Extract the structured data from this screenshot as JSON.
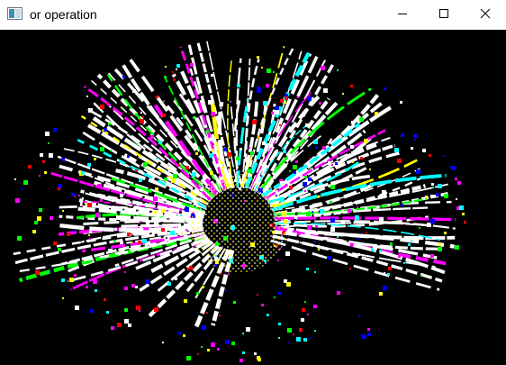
{
  "window": {
    "title": "or operation",
    "app_icon": "app-window-icon",
    "controls": [
      {
        "name": "minimize-button",
        "icon": "minimize-icon"
      },
      {
        "name": "maximize-button",
        "icon": "maximize-icon"
      },
      {
        "name": "close-button",
        "icon": "close-icon"
      }
    ]
  },
  "image": {
    "description_kind": "bitwise-or-result-image",
    "background_color": "#000000",
    "palette": [
      "#ffffff",
      "#ff00ff",
      "#00ff00",
      "#ffff00",
      "#00ffff",
      "#0000ff",
      "#ff0000"
    ]
  }
}
